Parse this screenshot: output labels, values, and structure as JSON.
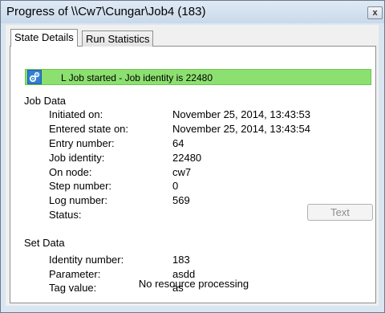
{
  "window": {
    "title": "Progress of \\\\Cw7\\Cungar\\Job4 (183)",
    "close_label": "x"
  },
  "tabs": [
    {
      "label": "State Details"
    },
    {
      "label": "Run Statistics"
    }
  ],
  "banner": {
    "text": "L  Job started  -  Job identity is 22480",
    "color": "#8ce070",
    "icon": "gears-icon"
  },
  "job_data": {
    "heading": "Job Data",
    "rows": [
      {
        "label": "Initiated on:",
        "value": "November 25, 2014, 13:43:53"
      },
      {
        "label": "Entered state on:",
        "value": "November 25, 2014, 13:43:54"
      },
      {
        "label": "Entry number:",
        "value": "64"
      },
      {
        "label": "Job identity:",
        "value": "22480"
      },
      {
        "label": "On node:",
        "value": "cw7"
      },
      {
        "label": "Step number:",
        "value": "0"
      },
      {
        "label": "Log number:",
        "value": "569"
      },
      {
        "label": "Status:",
        "value": ""
      }
    ],
    "text_button": "Text"
  },
  "set_data": {
    "heading": "Set Data",
    "rows": [
      {
        "label": "Identity number:",
        "value": "183"
      },
      {
        "label": "Parameter:",
        "value": "asdd"
      },
      {
        "label": "Tag value:",
        "value": "as"
      }
    ]
  },
  "footer": "No resource processing"
}
